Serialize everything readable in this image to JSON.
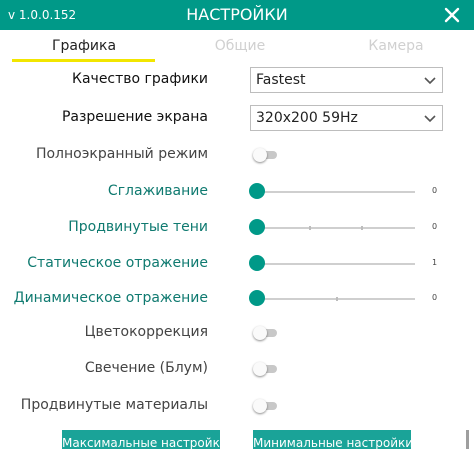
{
  "header": {
    "version": "v 1.0.0.152",
    "title": "НАСТРОЙКИ",
    "close_icon": "close-icon",
    "background": "#009988"
  },
  "tabs": [
    {
      "label": "Графика",
      "active": true
    },
    {
      "label": "Общие",
      "active": false
    },
    {
      "label": "Камера",
      "active": false
    }
  ],
  "settings": {
    "graphics_quality": {
      "label": "Качество графики",
      "value": "Fastest"
    },
    "resolution": {
      "label": "Разрешение экрана",
      "value": "320x200 59Hz"
    },
    "fullscreen": {
      "label": "Полноэкранный режим",
      "on": false
    },
    "antialiasing": {
      "label": "Сглаживание",
      "value": "0",
      "level": 0
    },
    "advanced_shadows": {
      "label": "Продвинутые тени",
      "value": "0",
      "level": 0
    },
    "static_reflection": {
      "label": "Статическое отражение",
      "value": "1",
      "level": 0
    },
    "dynamic_reflection": {
      "label": "Динамическое отражение",
      "value": "0",
      "level": 0
    },
    "color_correction": {
      "label": "Цветокоррекция",
      "on": false
    },
    "bloom": {
      "label": "Свечение (Блум)",
      "on": false
    },
    "advanced_materials": {
      "label": "Продвинутые материалы",
      "on": false
    }
  },
  "buttons": {
    "max_settings": "Максимальные настройки",
    "min_settings": "Минимальные настройки"
  },
  "colors": {
    "accent": "#009988",
    "tab_underline": "#f2e600",
    "button": "#1aa398",
    "label_teal": "#0f7a70"
  }
}
